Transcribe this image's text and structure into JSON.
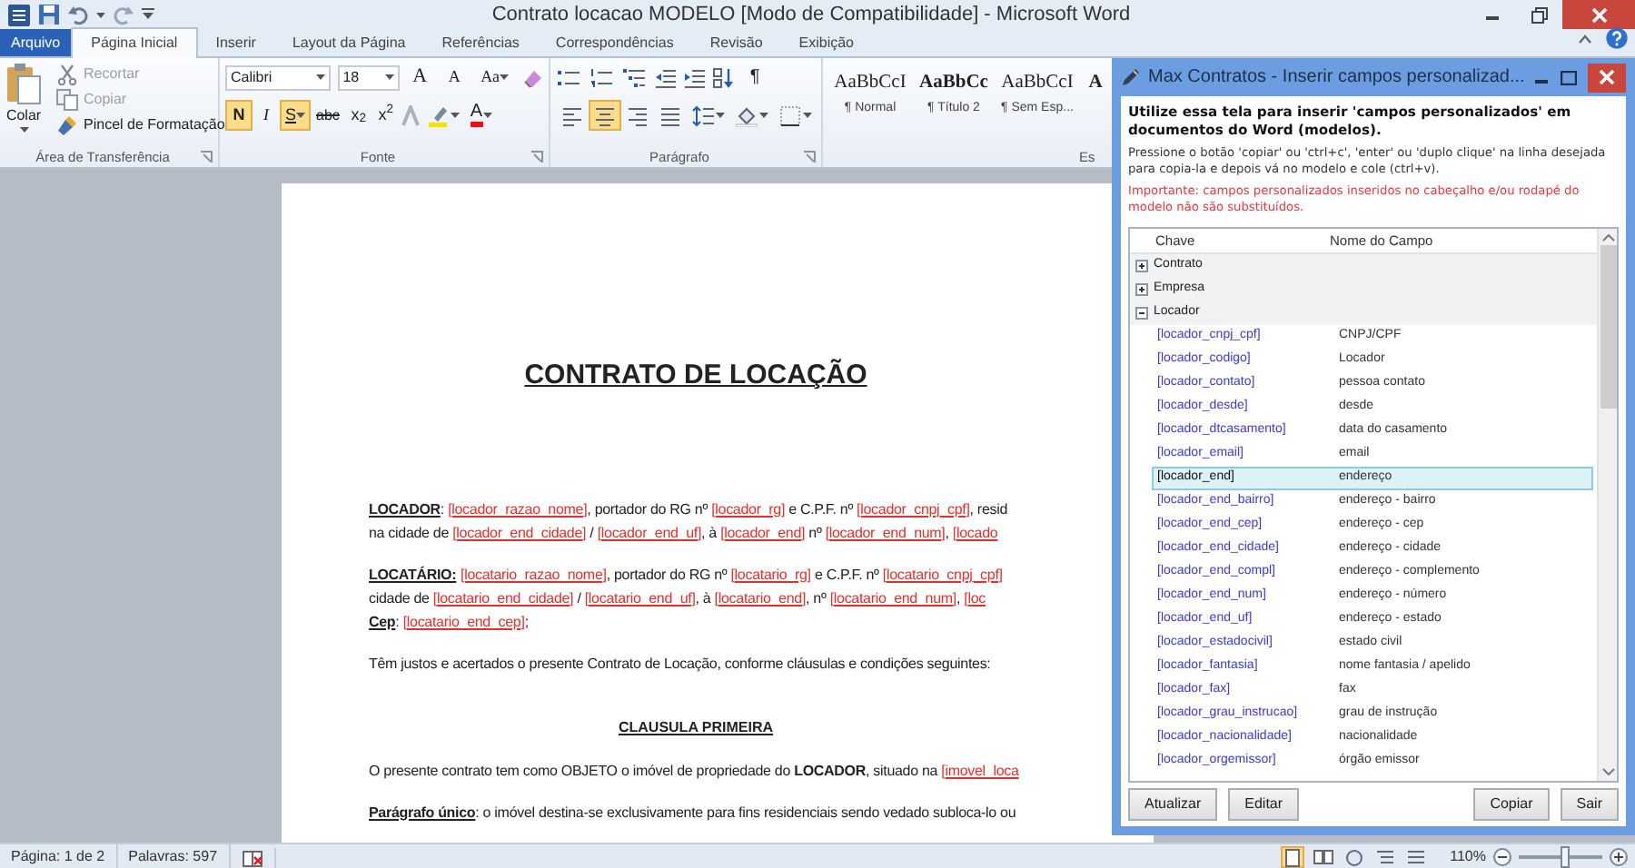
{
  "window": {
    "title": "Contrato locacao MODELO [Modo de Compatibilidade] - Microsoft Word"
  },
  "ribbon_tabs": [
    {
      "label": "Arquivo",
      "kind": "file",
      "selected": false
    },
    {
      "label": "Página Inicial",
      "kind": "tab",
      "selected": true
    },
    {
      "label": "Inserir",
      "kind": "tab",
      "selected": false
    },
    {
      "label": "Layout da Página",
      "kind": "tab",
      "selected": false
    },
    {
      "label": "Referências",
      "kind": "tab",
      "selected": false
    },
    {
      "label": "Correspondências",
      "kind": "tab",
      "selected": false
    },
    {
      "label": "Revisão",
      "kind": "tab",
      "selected": false
    },
    {
      "label": "Exibição",
      "kind": "tab",
      "selected": false
    }
  ],
  "clipboard": {
    "paste": "Colar",
    "items": [
      {
        "label": "Recortar",
        "kind": "cut",
        "disabled": true
      },
      {
        "label": "Copiar",
        "kind": "copy",
        "disabled": true
      },
      {
        "label": "Pincel de Formatação",
        "kind": "brush",
        "disabled": false
      }
    ],
    "group_label": "Área de Transferência"
  },
  "font": {
    "family": "Calibri",
    "size": "18",
    "tools": [
      {
        "label": "A",
        "kind": "grow"
      },
      {
        "label": "A",
        "kind": "shrink"
      },
      {
        "label": "Aa",
        "kind": "case"
      }
    ],
    "format_buttons": [
      {
        "label": "N",
        "kind": "bold",
        "on": true
      },
      {
        "label": "I",
        "kind": "italic",
        "on": false
      },
      {
        "label": "S",
        "kind": "underline",
        "on": true
      },
      {
        "label": "abc",
        "kind": "strike",
        "on": false
      },
      {
        "label": "x$_{2}$",
        "kind": "plain",
        "on": false
      },
      {
        "label": "x$^{2}$",
        "kind": "plain",
        "on": false
      }
    ],
    "color_label": "A",
    "group_label": "Fonte"
  },
  "paragraph": {
    "pilcrow": "¶",
    "align_buttons": [
      {
        "kind": "left",
        "on": false
      },
      {
        "kind": "center",
        "on": true
      },
      {
        "kind": "right",
        "on": false
      },
      {
        "kind": "justify",
        "on": false
      }
    ],
    "group_label": "Parágrafo"
  },
  "styles": {
    "items": [
      {
        "sample": "AaBbCcI",
        "name": "¶ Normal",
        "kind": "normal"
      },
      {
        "sample": "AaBbCc",
        "name": "¶ Título 2",
        "kind": "heading"
      },
      {
        "sample": "AaBbCcI",
        "name": "¶ Sem Esp...",
        "kind": "normal"
      },
      {
        "sample": "A",
        "kind": "heading"
      }
    ],
    "group_label": "Es"
  },
  "document": {
    "title": "CONTRATO DE LOCAÇÃO",
    "blocks": [
      {
        "kind": "paragraph",
        "lines": [
          [
            {
              "kind": "label",
              "text": "LOCADOR"
            },
            {
              "kind": "plain",
              "text": ": "
            },
            {
              "kind": "field",
              "text": "[locador_razao_nome]"
            },
            {
              "kind": "plain",
              "text": ", portador do RG nº "
            },
            {
              "kind": "field",
              "text": "[locador_rg]"
            },
            {
              "kind": "plain",
              "text": " e C.P.F. nº "
            },
            {
              "kind": "field",
              "text": "[locador_cnpj_cpf]"
            },
            {
              "kind": "plain",
              "text": ", resid"
            }
          ],
          [
            {
              "kind": "plain",
              "text": "na cidade de "
            },
            {
              "kind": "field",
              "text": "[locador_end_cidade]"
            },
            {
              "kind": "plain",
              "text": " / "
            },
            {
              "kind": "field",
              "text": "[locador_end_uf]"
            },
            {
              "kind": "plain",
              "text": ", à "
            },
            {
              "kind": "field",
              "text": "[locador_end]"
            },
            {
              "kind": "plain",
              "text": " nº "
            },
            {
              "kind": "field",
              "text": "[locador_end_num]"
            },
            {
              "kind": "field",
              "prefix": ", ",
              "text": "[locado"
            }
          ]
        ]
      },
      {
        "kind": "paragraph",
        "lines": [
          [
            {
              "kind": "label",
              "text": "LOCATÁRIO:"
            },
            {
              "kind": "field",
              "spaced": true,
              "text": "[locatario_razao_nome]"
            },
            {
              "kind": "plain",
              "text": ", portador do RG nº "
            },
            {
              "kind": "field",
              "text": "[locatario_rg]"
            },
            {
              "kind": "plain",
              "text": " e C.P.F. nº "
            },
            {
              "kind": "field",
              "text": "[locatario_cnpj_cpf]"
            }
          ],
          [
            {
              "kind": "plain",
              "text": "cidade de "
            },
            {
              "kind": "field",
              "text": "[locatario_end_cidade]"
            },
            {
              "kind": "plain",
              "text": " / "
            },
            {
              "kind": "field",
              "text": "[locatario_end_uf]"
            },
            {
              "kind": "plain",
              "text": ", à "
            },
            {
              "kind": "field",
              "text": "[locatario_end]"
            },
            {
              "kind": "plain",
              "text": ", nº "
            },
            {
              "kind": "field",
              "text": "[locatario_end_num]"
            },
            {
              "kind": "field",
              "prefix": ", ",
              "text": "[loc"
            }
          ],
          [
            {
              "kind": "label",
              "text": "Cep"
            },
            {
              "kind": "plain",
              "text": ": "
            },
            {
              "kind": "field",
              "text": "[locatario_end_cep]"
            },
            {
              "kind": "plain",
              "text": ";"
            }
          ]
        ]
      },
      {
        "kind": "paragraph",
        "lines": [
          [
            {
              "kind": "plain",
              "text": "Têm justos e acertados o presente Contrato de Locação, conforme cláusulas e condições seguintes:"
            }
          ]
        ]
      },
      {
        "kind": "heading",
        "text": "CLAUSULA PRIMEIRA"
      },
      {
        "kind": "paragraph",
        "lines": [
          [
            {
              "kind": "plain",
              "text": "O presente contrato tem como OBJETO o imóvel de propriedade do "
            },
            {
              "kind": "bold",
              "text": "LOCADOR"
            },
            {
              "kind": "plain",
              "text": ", situado na "
            },
            {
              "kind": "field",
              "text": "[imovel_loca"
            }
          ]
        ]
      },
      {
        "kind": "paragraph",
        "lines": [
          [
            {
              "kind": "label",
              "text": "Parágrafo único"
            },
            {
              "kind": "plain",
              "text": ": o imóvel destina-se exclusivamente para fins residenciais sendo vedado subloca-lo ou"
            }
          ]
        ]
      }
    ]
  },
  "dialog": {
    "title": "Max Contratos - Inserir campos personalizad...",
    "heading": "Utilize essa tela para inserir 'campos personalizados' em documentos do Word (modelos).",
    "instructions": "Pressione o botão 'copiar' ou 'ctrl+c', 'enter' ou 'duplo clique' na linha desejada para copia-la e depois vá no modelo e cole (ctrl+v).",
    "warning": "Importante: campos personalizados inseridos no cabeçalho e/ou rodapé do modelo não são substituídos.",
    "columns": [
      "Chave",
      "Nome do Campo"
    ],
    "groups": [
      {
        "label": "Contrato",
        "expanded": false
      },
      {
        "label": "Empresa",
        "expanded": false
      },
      {
        "label": "Locador",
        "expanded": true,
        "children": [
          {
            "key": "[locador_cnpj_cpf]",
            "name": "CNPJ/CPF",
            "selected": false
          },
          {
            "key": "[locador_codigo]",
            "name": "Locador",
            "selected": false
          },
          {
            "key": "[locador_contato]",
            "name": "pessoa contato",
            "selected": false
          },
          {
            "key": "[locador_desde]",
            "name": "desde",
            "selected": false
          },
          {
            "key": "[locador_dtcasamento]",
            "name": "data do casamento",
            "selected": false
          },
          {
            "key": "[locador_email]",
            "name": "email",
            "selected": false
          },
          {
            "key": "[locador_end]",
            "name": "endereço",
            "selected": true
          },
          {
            "key": "[locador_end_bairro]",
            "name": "endereço - bairro",
            "selected": false
          },
          {
            "key": "[locador_end_cep]",
            "name": "endereço - cep",
            "selected": false
          },
          {
            "key": "[locador_end_cidade]",
            "name": "endereço - cidade",
            "selected": false
          },
          {
            "key": "[locador_end_compl]",
            "name": "endereço - complemento",
            "selected": false
          },
          {
            "key": "[locador_end_num]",
            "name": "endereço - número",
            "selected": false
          },
          {
            "key": "[locador_end_uf]",
            "name": "endereço - estado",
            "selected": false
          },
          {
            "key": "[locador_estadocivil]",
            "name": "estado civil",
            "selected": false
          },
          {
            "key": "[locador_fantasia]",
            "name": "nome fantasia / apelido",
            "selected": false
          },
          {
            "key": "[locador_fax]",
            "name": "fax",
            "selected": false
          },
          {
            "key": "[locador_grau_instrucao]",
            "name": "grau de instrução",
            "selected": false
          },
          {
            "key": "[locador_nacionalidade]",
            "name": "nacionalidade",
            "selected": false
          },
          {
            "key": "[locador_orgemissor]",
            "name": "órgão emissor",
            "selected": false
          }
        ]
      }
    ],
    "buttons_left": [
      "Atualizar",
      "Editar"
    ],
    "buttons_right": [
      "Copiar",
      "Sair"
    ]
  },
  "status_bar": {
    "page": "Página: 1 de 2",
    "words": "Palavras: 597",
    "views": [
      {
        "kind": "print",
        "selected": true
      },
      {
        "kind": "reading",
        "selected": false
      },
      {
        "kind": "web",
        "selected": false
      },
      {
        "kind": "outline",
        "selected": false
      },
      {
        "kind": "draft",
        "selected": false
      }
    ],
    "zoom": "110%",
    "zoom_slider": {
      "level": 0.55
    }
  }
}
